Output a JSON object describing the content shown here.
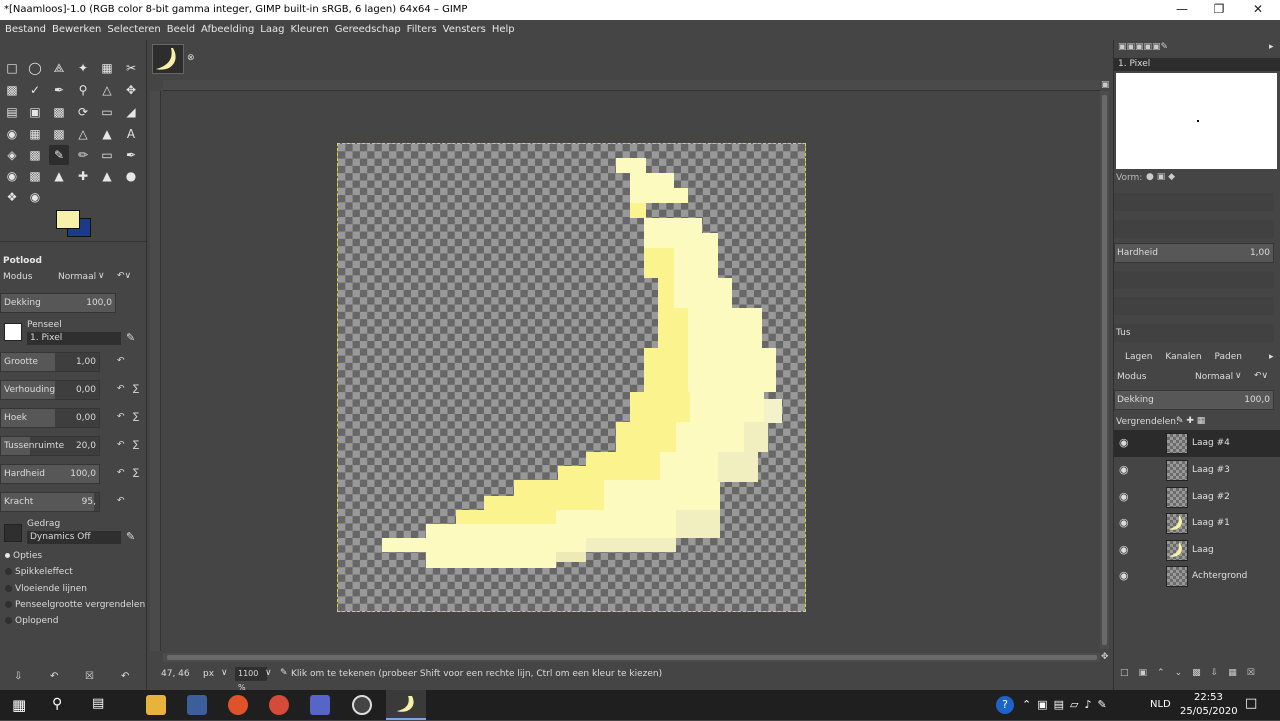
{
  "window": {
    "title": "*[Naamloos]-1.0 (RGB color 8-bit gamma integer, GIMP built-in sRGB, 6 lagen) 64x64 – GIMP"
  },
  "menu": [
    "Bestand",
    "Bewerken",
    "Selecteren",
    "Beeld",
    "Afbeelding",
    "Laag",
    "Kleuren",
    "Gereedschap",
    "Filters",
    "Vensters",
    "Help"
  ],
  "tool_options": {
    "title": "Potlood",
    "mode_label": "Modus",
    "mode_value": "Normaal",
    "opacity_label": "Dekking",
    "opacity_value": "100,0",
    "brush_label": "Penseel",
    "brush_value": "1. Pixel",
    "params": [
      {
        "label": "Grootte",
        "value": "1,00"
      },
      {
        "label": "Verhouding",
        "value": "0,00"
      },
      {
        "label": "Hoek",
        "value": "0,00"
      },
      {
        "label": "Tussenruimte",
        "value": "20,0"
      },
      {
        "label": "Hardheid",
        "value": "100,0"
      },
      {
        "label": "Kracht",
        "value": "95,"
      }
    ],
    "dynamics_label": "Gedrag",
    "dynamics_value": "Dynamics Off",
    "checks": [
      "Opties",
      "Spikkeleffect",
      "Vloeiende lijnen",
      "Penseelgrootte vergrendelen",
      "Oplopend"
    ]
  },
  "colors": {
    "foreground": "#f6f0a8",
    "background": "#1b3a8a"
  },
  "brushes": {
    "name": "1. Pixel",
    "shape_label": "Vorm:",
    "hardness_label": "Hardheid",
    "hardness_value": "1,00",
    "partial_label": "Tus"
  },
  "layers_panel": {
    "tabs": [
      "Lagen",
      "Kanalen",
      "Paden"
    ],
    "mode_label": "Modus",
    "mode_value": "Normaal",
    "opacity_label": "Dekking",
    "opacity_value": "100,0",
    "lock_label": "Vergrendelen:",
    "layers": [
      "Laag #4",
      "Laag #3",
      "Laag #2",
      "Laag #1",
      "Laag",
      "Achtergrond"
    ]
  },
  "status": {
    "coords": "47, 46",
    "unit": "px",
    "zoom": "1100 %",
    "message": "Klik om te tekenen (probeer Shift voor een rechte lijn, Ctrl om een kleur te kiezen)"
  },
  "taskbar": {
    "lang": "NLD",
    "time": "22:53",
    "date": "25/05/2020"
  }
}
